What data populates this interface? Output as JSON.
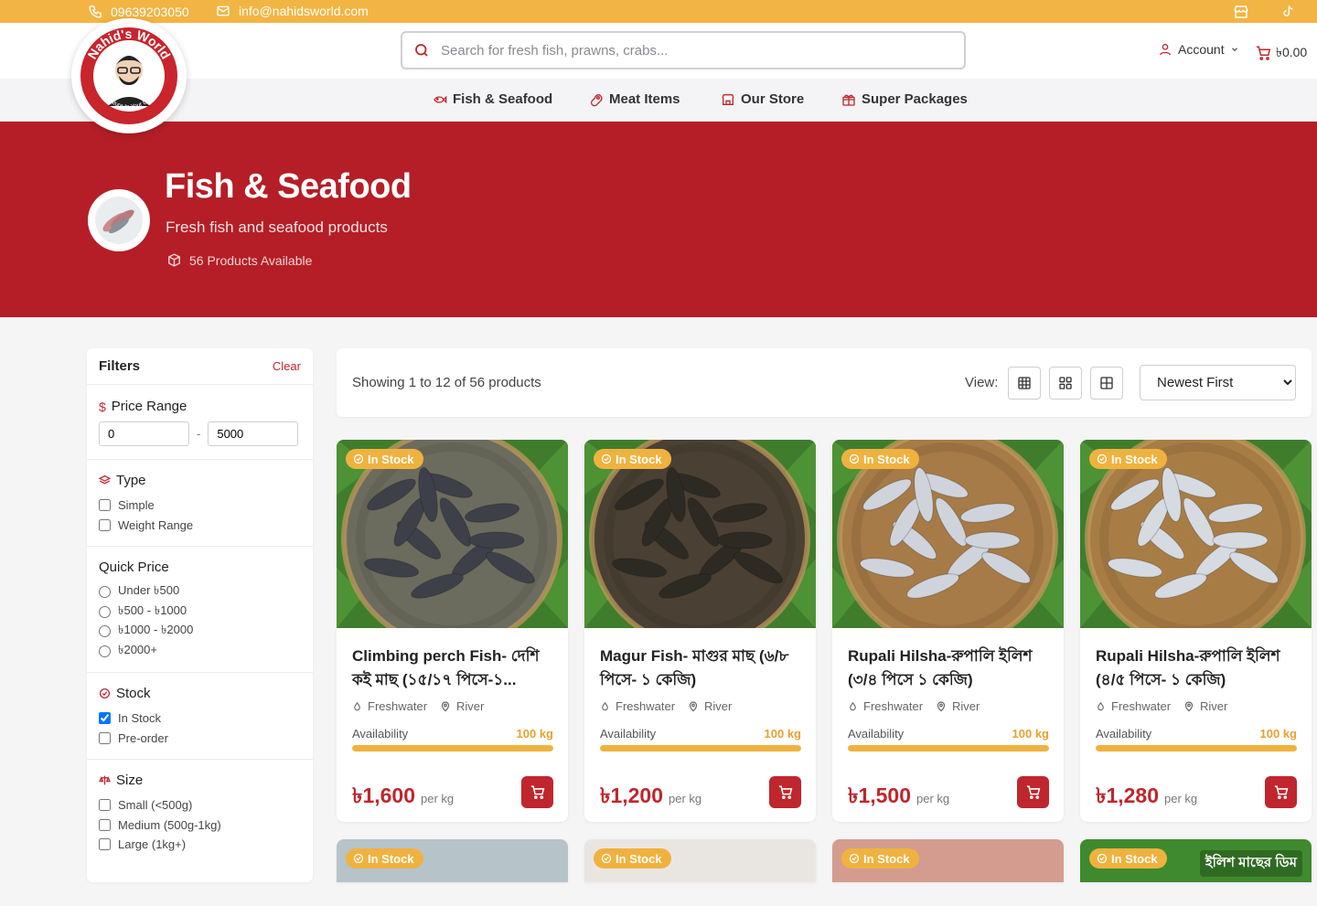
{
  "topbar": {
    "phone": "09639203050",
    "email": "info@nahidsworld.com",
    "icons": [
      "store-icon",
      "tiktok-icon"
    ]
  },
  "brand": {
    "logo_text": "Nahid's World",
    "logo_tagline": "From Nature to Your Doorstep"
  },
  "search": {
    "placeholder": "Search for fresh fish, prawns, crabs..."
  },
  "account": {
    "label": "Account"
  },
  "cart": {
    "total": "৳0.00"
  },
  "nav": [
    {
      "label": "Fish & Seafood",
      "icon": "fish-icon"
    },
    {
      "label": "Meat Items",
      "icon": "meat-icon"
    },
    {
      "label": "Our Store",
      "icon": "store-icon"
    },
    {
      "label": "Super Packages",
      "icon": "gift-icon"
    }
  ],
  "hero": {
    "title": "Fish & Seafood",
    "subtitle": "Fresh fish and seafood products",
    "count": "56 Products Available"
  },
  "filters": {
    "title": "Filters",
    "clear": "Clear",
    "price_range": {
      "label": "Price Range",
      "min": "0",
      "max": "5000",
      "sep": "-"
    },
    "type": {
      "label": "Type",
      "options": [
        "Simple",
        "Weight Range"
      ]
    },
    "quick_price": {
      "label": "Quick Price",
      "options": [
        "Under ৳500",
        "৳500 - ৳1000",
        "৳1000 - ৳2000",
        "৳2000+"
      ]
    },
    "stock": {
      "label": "Stock",
      "options": [
        {
          "label": "In Stock",
          "checked": true
        },
        {
          "label": "Pre-order",
          "checked": false
        }
      ]
    },
    "size": {
      "label": "Size",
      "options": [
        "Small (<500g)",
        "Medium (500g-1kg)",
        "Large (1kg+)"
      ]
    }
  },
  "results": {
    "showing": "Showing 1 to 12 of 56 products",
    "view_label": "View:",
    "sort_selected": "Newest First"
  },
  "products": [
    {
      "badge": "In Stock",
      "name": "Climbing perch Fish- দেশি কই মাছ (১৫/১৭ পিসে-১...",
      "tag1": "Freshwater",
      "tag2": "River",
      "avail_label": "Availability",
      "avail_value": "100 kg",
      "stock_fill": 1.0,
      "price": "৳1,600",
      "unit": "per kg",
      "img_tone": "#6c6c5e",
      "fish_tone": "#3d4049"
    },
    {
      "badge": "In Stock",
      "name": "Magur Fish- মাগুর মাছ (৬/৮ পিসে- ১ কেজি)",
      "tag1": "Freshwater",
      "tag2": "River",
      "avail_label": "Availability",
      "avail_value": "100 kg",
      "stock_fill": 1.0,
      "price": "৳1,200",
      "unit": "per kg",
      "img_tone": "#4a4034",
      "fish_tone": "#2d2a23"
    },
    {
      "badge": "In Stock",
      "name": "Rupali Hilsha-রুপালি ইলিশ (৩/৪ পিসে ১ কেজি)",
      "tag1": "Freshwater",
      "tag2": "River",
      "avail_label": "Availability",
      "avail_value": "100 kg",
      "stock_fill": 1.0,
      "price": "৳1,500",
      "unit": "per kg",
      "img_tone": "#a67b47",
      "fish_tone": "#cfd4dc"
    },
    {
      "badge": "In Stock",
      "name": "Rupali Hilsha-রুপালি ইলিশ (৪/৫ পিসে- ১ কেজি)",
      "tag1": "Freshwater",
      "tag2": "River",
      "avail_label": "Availability",
      "avail_value": "100 kg",
      "stock_fill": 1.0,
      "price": "৳1,280",
      "unit": "per kg",
      "img_tone": "#a87d45",
      "fish_tone": "#d6dbe2"
    }
  ],
  "products_row2": [
    {
      "badge": "In Stock",
      "img_tone": "#b6c3c9"
    },
    {
      "badge": "In Stock",
      "img_tone": "#e9e6e2"
    },
    {
      "badge": "In Stock",
      "img_tone": "#d49c8e"
    },
    {
      "badge": "In Stock",
      "img_tone": "#3f8a2e",
      "overlay_text": "ইলিশ মাছের ডিম"
    }
  ],
  "colors": {
    "brand_red": "#b51e26",
    "accent_yellow": "#f2b543",
    "price_red": "#c0262d"
  }
}
